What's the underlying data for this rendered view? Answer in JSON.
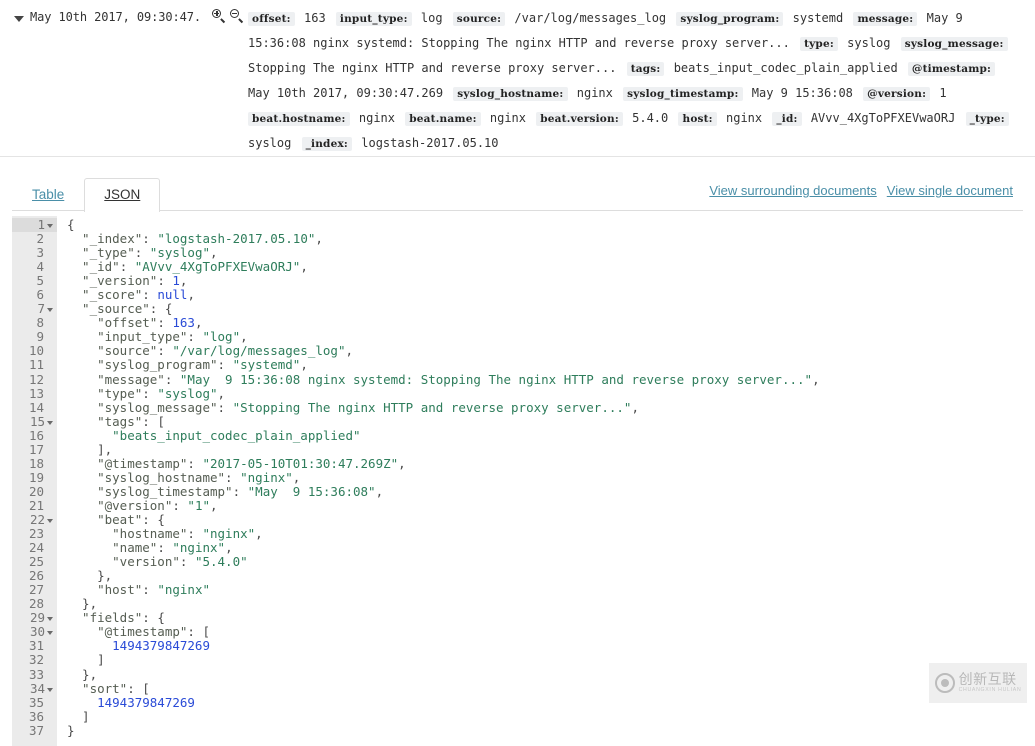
{
  "doc_header": {
    "timestamp": "May 10th 2017, 09:30:47.",
    "zoom_in_icon": "magnify-plus-icon",
    "zoom_out_icon": "magnify-minus-icon",
    "fields": [
      {
        "key": "offset",
        "value": "163"
      },
      {
        "key": "input_type",
        "value": "log"
      },
      {
        "key": "source",
        "value": "/var/log/messages_log"
      },
      {
        "key": "syslog_program",
        "value": "systemd"
      },
      {
        "key": "message",
        "value": "May 9 15:36:08 nginx systemd: Stopping The nginx HTTP and reverse proxy server..."
      },
      {
        "key": "type",
        "value": "syslog"
      },
      {
        "key": "syslog_message",
        "value": "Stopping The nginx HTTP and reverse proxy server..."
      },
      {
        "key": "tags",
        "value": "beats_input_codec_plain_applied"
      },
      {
        "key": "@timestamp",
        "value": "May 10th 2017, 09:30:47.269"
      },
      {
        "key": "syslog_hostname",
        "value": "nginx"
      },
      {
        "key": "syslog_timestamp",
        "value": "May 9 15:36:08"
      },
      {
        "key": "@version",
        "value": "1"
      },
      {
        "key": "beat.hostname",
        "value": "nginx"
      },
      {
        "key": "beat.name",
        "value": "nginx"
      },
      {
        "key": "beat.version",
        "value": "5.4.0"
      },
      {
        "key": "host",
        "value": "nginx"
      },
      {
        "key": "_id",
        "value": "AVvv_4XgToPFXEVwaORJ"
      },
      {
        "key": "_type",
        "value": "syslog"
      },
      {
        "key": "_index",
        "value": "logstash-2017.05.10"
      }
    ]
  },
  "tabs": [
    {
      "label": "Table",
      "active": false
    },
    {
      "label": "JSON",
      "active": true
    }
  ],
  "links": [
    {
      "label": "View surrounding documents"
    },
    {
      "label": "View single document"
    }
  ],
  "json_view": {
    "lines": [
      {
        "num": 1,
        "fold": true,
        "tokens": [
          {
            "t": "p",
            "v": "{"
          }
        ]
      },
      {
        "num": 2,
        "fold": false,
        "tokens": [
          {
            "t": "k",
            "v": "  \"_index\""
          },
          {
            "t": "p",
            "v": ": "
          },
          {
            "t": "s",
            "v": "\"logstash-2017.05.10\""
          },
          {
            "t": "p",
            "v": ","
          }
        ]
      },
      {
        "num": 3,
        "fold": false,
        "tokens": [
          {
            "t": "k",
            "v": "  \"_type\""
          },
          {
            "t": "p",
            "v": ": "
          },
          {
            "t": "s",
            "v": "\"syslog\""
          },
          {
            "t": "p",
            "v": ","
          }
        ]
      },
      {
        "num": 4,
        "fold": false,
        "tokens": [
          {
            "t": "k",
            "v": "  \"_id\""
          },
          {
            "t": "p",
            "v": ": "
          },
          {
            "t": "s",
            "v": "\"AVvv_4XgToPFXEVwaORJ\""
          },
          {
            "t": "p",
            "v": ","
          }
        ]
      },
      {
        "num": 5,
        "fold": false,
        "tokens": [
          {
            "t": "k",
            "v": "  \"_version\""
          },
          {
            "t": "p",
            "v": ": "
          },
          {
            "t": "n",
            "v": "1"
          },
          {
            "t": "p",
            "v": ","
          }
        ]
      },
      {
        "num": 6,
        "fold": false,
        "tokens": [
          {
            "t": "k",
            "v": "  \"_score\""
          },
          {
            "t": "p",
            "v": ": "
          },
          {
            "t": "n",
            "v": "null"
          },
          {
            "t": "p",
            "v": ","
          }
        ]
      },
      {
        "num": 7,
        "fold": true,
        "tokens": [
          {
            "t": "k",
            "v": "  \"_source\""
          },
          {
            "t": "p",
            "v": ": {"
          }
        ]
      },
      {
        "num": 8,
        "fold": false,
        "tokens": [
          {
            "t": "k",
            "v": "    \"offset\""
          },
          {
            "t": "p",
            "v": ": "
          },
          {
            "t": "n",
            "v": "163"
          },
          {
            "t": "p",
            "v": ","
          }
        ]
      },
      {
        "num": 9,
        "fold": false,
        "tokens": [
          {
            "t": "k",
            "v": "    \"input_type\""
          },
          {
            "t": "p",
            "v": ": "
          },
          {
            "t": "s",
            "v": "\"log\""
          },
          {
            "t": "p",
            "v": ","
          }
        ]
      },
      {
        "num": 10,
        "fold": false,
        "tokens": [
          {
            "t": "k",
            "v": "    \"source\""
          },
          {
            "t": "p",
            "v": ": "
          },
          {
            "t": "s",
            "v": "\"/var/log/messages_log\""
          },
          {
            "t": "p",
            "v": ","
          }
        ]
      },
      {
        "num": 11,
        "fold": false,
        "tokens": [
          {
            "t": "k",
            "v": "    \"syslog_program\""
          },
          {
            "t": "p",
            "v": ": "
          },
          {
            "t": "s",
            "v": "\"systemd\""
          },
          {
            "t": "p",
            "v": ","
          }
        ]
      },
      {
        "num": 12,
        "fold": false,
        "tokens": [
          {
            "t": "k",
            "v": "    \"message\""
          },
          {
            "t": "p",
            "v": ": "
          },
          {
            "t": "s",
            "v": "\"May  9 15:36:08 nginx systemd: Stopping The nginx HTTP and reverse proxy server...\""
          },
          {
            "t": "p",
            "v": ","
          }
        ]
      },
      {
        "num": 13,
        "fold": false,
        "tokens": [
          {
            "t": "k",
            "v": "    \"type\""
          },
          {
            "t": "p",
            "v": ": "
          },
          {
            "t": "s",
            "v": "\"syslog\""
          },
          {
            "t": "p",
            "v": ","
          }
        ]
      },
      {
        "num": 14,
        "fold": false,
        "tokens": [
          {
            "t": "k",
            "v": "    \"syslog_message\""
          },
          {
            "t": "p",
            "v": ": "
          },
          {
            "t": "s",
            "v": "\"Stopping The nginx HTTP and reverse proxy server...\""
          },
          {
            "t": "p",
            "v": ","
          }
        ]
      },
      {
        "num": 15,
        "fold": true,
        "tokens": [
          {
            "t": "k",
            "v": "    \"tags\""
          },
          {
            "t": "p",
            "v": ": ["
          }
        ]
      },
      {
        "num": 16,
        "fold": false,
        "tokens": [
          {
            "t": "s",
            "v": "      \"beats_input_codec_plain_applied\""
          }
        ]
      },
      {
        "num": 17,
        "fold": false,
        "tokens": [
          {
            "t": "p",
            "v": "    ],"
          }
        ]
      },
      {
        "num": 18,
        "fold": false,
        "tokens": [
          {
            "t": "k",
            "v": "    \"@timestamp\""
          },
          {
            "t": "p",
            "v": ": "
          },
          {
            "t": "s",
            "v": "\"2017-05-10T01:30:47.269Z\""
          },
          {
            "t": "p",
            "v": ","
          }
        ]
      },
      {
        "num": 19,
        "fold": false,
        "tokens": [
          {
            "t": "k",
            "v": "    \"syslog_hostname\""
          },
          {
            "t": "p",
            "v": ": "
          },
          {
            "t": "s",
            "v": "\"nginx\""
          },
          {
            "t": "p",
            "v": ","
          }
        ]
      },
      {
        "num": 20,
        "fold": false,
        "tokens": [
          {
            "t": "k",
            "v": "    \"syslog_timestamp\""
          },
          {
            "t": "p",
            "v": ": "
          },
          {
            "t": "s",
            "v": "\"May  9 15:36:08\""
          },
          {
            "t": "p",
            "v": ","
          }
        ]
      },
      {
        "num": 21,
        "fold": false,
        "tokens": [
          {
            "t": "k",
            "v": "    \"@version\""
          },
          {
            "t": "p",
            "v": ": "
          },
          {
            "t": "s",
            "v": "\"1\""
          },
          {
            "t": "p",
            "v": ","
          }
        ]
      },
      {
        "num": 22,
        "fold": true,
        "tokens": [
          {
            "t": "k",
            "v": "    \"beat\""
          },
          {
            "t": "p",
            "v": ": {"
          }
        ]
      },
      {
        "num": 23,
        "fold": false,
        "tokens": [
          {
            "t": "k",
            "v": "      \"hostname\""
          },
          {
            "t": "p",
            "v": ": "
          },
          {
            "t": "s",
            "v": "\"nginx\""
          },
          {
            "t": "p",
            "v": ","
          }
        ]
      },
      {
        "num": 24,
        "fold": false,
        "tokens": [
          {
            "t": "k",
            "v": "      \"name\""
          },
          {
            "t": "p",
            "v": ": "
          },
          {
            "t": "s",
            "v": "\"nginx\""
          },
          {
            "t": "p",
            "v": ","
          }
        ]
      },
      {
        "num": 25,
        "fold": false,
        "tokens": [
          {
            "t": "k",
            "v": "      \"version\""
          },
          {
            "t": "p",
            "v": ": "
          },
          {
            "t": "s",
            "v": "\"5.4.0\""
          }
        ]
      },
      {
        "num": 26,
        "fold": false,
        "tokens": [
          {
            "t": "p",
            "v": "    },"
          }
        ]
      },
      {
        "num": 27,
        "fold": false,
        "tokens": [
          {
            "t": "k",
            "v": "    \"host\""
          },
          {
            "t": "p",
            "v": ": "
          },
          {
            "t": "s",
            "v": "\"nginx\""
          }
        ]
      },
      {
        "num": 28,
        "fold": false,
        "tokens": [
          {
            "t": "p",
            "v": "  },"
          }
        ]
      },
      {
        "num": 29,
        "fold": true,
        "tokens": [
          {
            "t": "k",
            "v": "  \"fields\""
          },
          {
            "t": "p",
            "v": ": {"
          }
        ]
      },
      {
        "num": 30,
        "fold": true,
        "tokens": [
          {
            "t": "k",
            "v": "    \"@timestamp\""
          },
          {
            "t": "p",
            "v": ": ["
          }
        ]
      },
      {
        "num": 31,
        "fold": false,
        "tokens": [
          {
            "t": "n",
            "v": "      1494379847269"
          }
        ]
      },
      {
        "num": 32,
        "fold": false,
        "tokens": [
          {
            "t": "p",
            "v": "    ]"
          }
        ]
      },
      {
        "num": 33,
        "fold": false,
        "tokens": [
          {
            "t": "p",
            "v": "  },"
          }
        ]
      },
      {
        "num": 34,
        "fold": true,
        "tokens": [
          {
            "t": "k",
            "v": "  \"sort\""
          },
          {
            "t": "p",
            "v": ": ["
          }
        ]
      },
      {
        "num": 35,
        "fold": false,
        "tokens": [
          {
            "t": "n",
            "v": "    1494379847269"
          }
        ]
      },
      {
        "num": 36,
        "fold": false,
        "tokens": [
          {
            "t": "p",
            "v": "  ]"
          }
        ]
      },
      {
        "num": 37,
        "fold": false,
        "tokens": [
          {
            "t": "p",
            "v": "}"
          }
        ]
      }
    ]
  },
  "watermark": {
    "cn": "创新互联",
    "en": "CHUANGXIN HULIAN"
  },
  "colors": {
    "link": "#4a8fa8",
    "json_key": "#555d52",
    "json_string": "#2e7d5b",
    "json_number": "#2a4bd7",
    "field_key_bg": "#eef0f2"
  }
}
